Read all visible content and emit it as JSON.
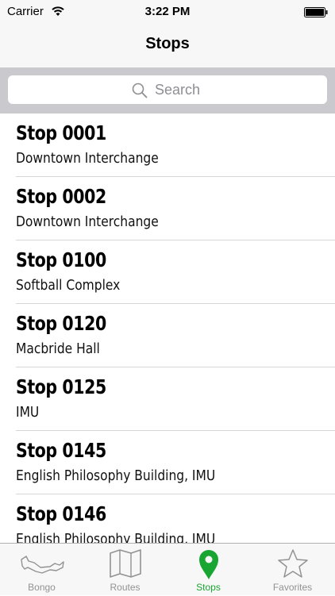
{
  "status_bar": {
    "carrier": "Carrier",
    "time": "3:22 PM"
  },
  "nav": {
    "title": "Stops"
  },
  "search": {
    "placeholder": "Search",
    "icon": "search-icon"
  },
  "stops": [
    {
      "title": "Stop 0001",
      "subtitle": "Downtown Interchange"
    },
    {
      "title": "Stop 0002",
      "subtitle": "Downtown Interchange"
    },
    {
      "title": "Stop 0100",
      "subtitle": "Softball Complex"
    },
    {
      "title": "Stop 0120",
      "subtitle": "Macbride Hall"
    },
    {
      "title": "Stop 0125",
      "subtitle": "IMU"
    },
    {
      "title": "Stop 0145",
      "subtitle": "English Philosophy Building, IMU"
    },
    {
      "title": "Stop 0146",
      "subtitle": "English Philosophy Building, IMU"
    }
  ],
  "tabs": [
    {
      "label": "Bongo",
      "icon": "bongo-map-icon",
      "active": false
    },
    {
      "label": "Routes",
      "icon": "map-icon",
      "active": false
    },
    {
      "label": "Stops",
      "icon": "location-pin-icon",
      "active": true
    },
    {
      "label": "Favorites",
      "icon": "star-icon",
      "active": false
    }
  ],
  "colors": {
    "accent": "#19a532",
    "inactive_tab": "#929292",
    "bar_background": "#f7f7f7",
    "search_area": "#c9c9ce"
  }
}
